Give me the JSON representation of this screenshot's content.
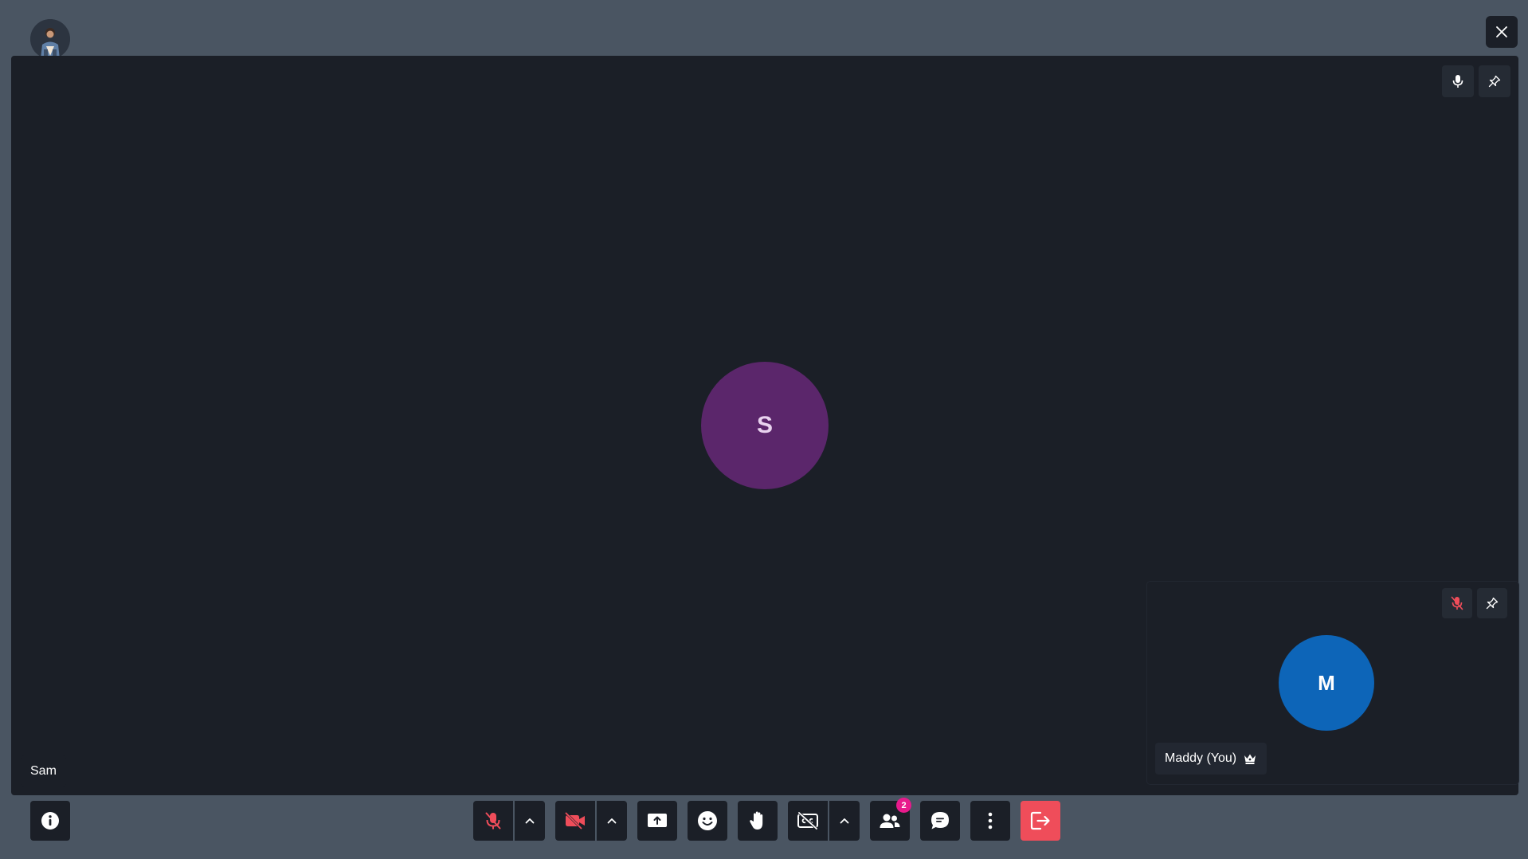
{
  "colors": {
    "background": "#4a5562",
    "stage": "#1b1f27",
    "accent_danger": "#ef4d5a",
    "main_avatar": "#5b266b",
    "self_avatar": "#0d65b8",
    "badge": "#e81a8c"
  },
  "header": {
    "user_avatar_icon": "user-photo-avatar",
    "close_icon": "close-icon"
  },
  "main_participant": {
    "name": "Sam",
    "initial": "S",
    "mic_icon": "microphone-icon",
    "pin_icon": "pin-icon"
  },
  "self_participant": {
    "name": "Maddy (You)",
    "initial": "M",
    "host_icon": "crown-icon",
    "mic_icon": "microphone-muted-icon",
    "pin_icon": "pin-icon"
  },
  "toolbar": {
    "info_icon": "info-icon",
    "buttons": [
      "microphone-muted-icon",
      "chevron-up-icon",
      "camera-off-icon",
      "chevron-up-icon",
      "screen-share-icon",
      "emoji-icon",
      "raise-hand-icon",
      "captions-off-icon",
      "chevron-up-icon",
      "participants-icon",
      "chat-icon",
      "more-options-icon",
      "leave-call-icon"
    ],
    "participants_count": "2"
  }
}
